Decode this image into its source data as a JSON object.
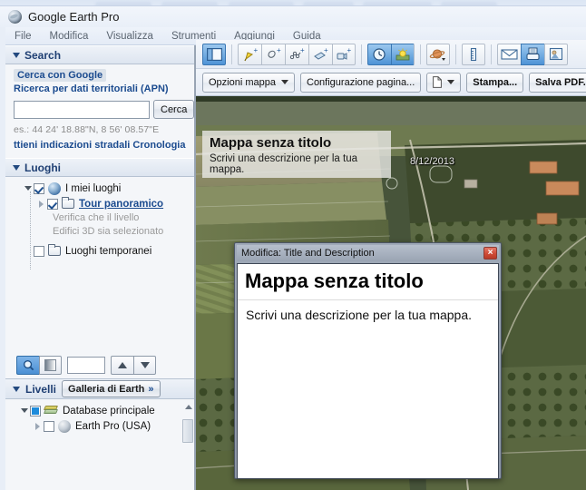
{
  "window": {
    "app_title": "Google Earth Pro",
    "app_icon": "earth-globe-icon"
  },
  "menubar": {
    "items": [
      {
        "label": "File"
      },
      {
        "label": "Modifica"
      },
      {
        "label": "Visualizza"
      },
      {
        "label": "Strumenti"
      },
      {
        "label": "Aggiungi"
      },
      {
        "label": "Guida"
      }
    ]
  },
  "search_panel": {
    "header": "Search",
    "tab_google": "Cerca con Google",
    "apn_link": "Ricerca per dati territoriali (APN)",
    "input_value": "",
    "input_placeholder": "",
    "search_button": "Cerca",
    "hint": "es.: 44 24' 18.88\"N, 8 56' 08.57\"E",
    "links": "ttieni indicazioni stradali Cronologia"
  },
  "places_panel": {
    "header": "Luoghi",
    "items": [
      {
        "label": "I miei luoghi",
        "icon": "earth-globe-icon",
        "checked": true,
        "expanded": true,
        "level": 0
      },
      {
        "label": "Tour panoramico",
        "icon": "folder-icon",
        "checked": true,
        "expanded": false,
        "level": 1,
        "is_link": true
      },
      {
        "label": "Luoghi temporanei",
        "icon": "folder-icon",
        "checked": false,
        "expanded": false,
        "level": 0
      }
    ],
    "note_line1": "Verifica che il livello",
    "note_line2": "Edifici 3D sia selezionato",
    "toolbar": {
      "search_icon": "magnifier-icon",
      "gradient_icon": "tour-slider-icon",
      "slider_value": "",
      "up_icon": "arrow-up-icon",
      "down_icon": "arrow-down-icon"
    }
  },
  "layers_panel": {
    "header": "Livelli",
    "gallery_button": "Galleria di Earth",
    "gallery_chevron": "»",
    "items": [
      {
        "label": "Database principale",
        "icon": "layers-stack-icon",
        "checked": true,
        "expanded": true,
        "level": 0
      },
      {
        "label": "Earth Pro (USA)",
        "icon": "earth-globe-grey-icon",
        "checked": false,
        "expanded": false,
        "level": 1
      }
    ]
  },
  "toolbar_main": {
    "icons": [
      {
        "name": "hide-sidebar-icon",
        "glyph": "sidebar",
        "active": true
      },
      {
        "name": "add-placemark-icon",
        "glyph": "placemark",
        "active": false
      },
      {
        "name": "add-polygon-icon",
        "glyph": "polygon",
        "active": false
      },
      {
        "name": "add-path-icon",
        "glyph": "path",
        "active": false
      },
      {
        "name": "add-image-overlay-icon",
        "glyph": "overlay",
        "active": false
      },
      {
        "name": "record-tour-icon",
        "glyph": "camera",
        "active": false
      },
      {
        "name": "historical-imagery-icon",
        "glyph": "clock",
        "active": true
      },
      {
        "name": "sunlight-icon",
        "glyph": "sun",
        "active": true
      },
      {
        "name": "planets-icon",
        "glyph": "planet",
        "active": false
      },
      {
        "name": "ruler-icon",
        "glyph": "ruler",
        "active": false
      },
      {
        "name": "email-icon",
        "glyph": "envelope",
        "active": false
      },
      {
        "name": "print-icon",
        "glyph": "printer",
        "active": true
      },
      {
        "name": "save-image-icon",
        "glyph": "saveimage",
        "active": false
      }
    ]
  },
  "toolbar_print": {
    "map_options": "Opzioni mappa",
    "page_setup": "Configurazione pagina...",
    "page_icon": "page-icon",
    "print": "Stampa...",
    "save_pdf": "Salva PDF..."
  },
  "map": {
    "date_stamp": "8/12/2013",
    "overlay_title": "Mappa senza titolo",
    "overlay_description": "Scrivi una descrizione per la tua mappa."
  },
  "dialog": {
    "title": "Modifica: Title and Description",
    "close_label": "×",
    "heading": "Mappa senza titolo",
    "body_text": "Scrivi una descrizione per la tua mappa."
  },
  "colors": {
    "accent_blue": "#1b4b8f",
    "toolbar_active": "#4e93d6",
    "close_red": "#cf4a36"
  }
}
